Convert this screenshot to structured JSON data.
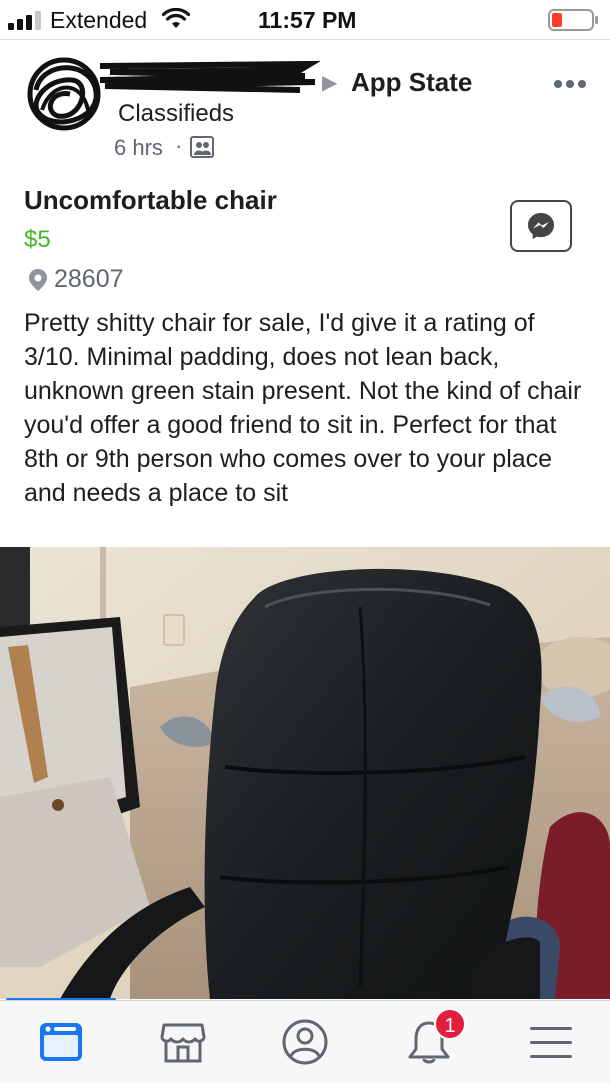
{
  "status_bar": {
    "carrier": "Extended",
    "time": "11:57 PM",
    "signal_icon": "cell-signal-icon",
    "wifi_icon": "wifi-icon",
    "battery_icon": "battery-low-icon",
    "battery_color": "#ff3b30"
  },
  "post": {
    "group_name": "App State",
    "page_name": "Classifieds",
    "time": "6 hrs",
    "separator": "·",
    "audience_icon": "group-audience-icon",
    "more_icon": "more-options-icon"
  },
  "listing": {
    "title": "Uncomfortable chair",
    "price": "$5",
    "zip": "28607",
    "description": "Pretty shitty chair for sale, I'd give it a rating of 3/10. Minimal padding, does not lean back, unknown green stain present. Not the kind of chair you'd offer a good friend to sit in. Perfect for that 8th or 9th person who comes over to your place and needs a place to sit",
    "price_color": "#42b72a",
    "message_icon": "messenger-icon"
  },
  "photo": {
    "subject": "black leather office chair photo"
  },
  "bottom_nav": {
    "items": [
      {
        "icon": "news-feed-icon",
        "active": true
      },
      {
        "icon": "marketplace-icon",
        "active": false
      },
      {
        "icon": "profile-icon",
        "active": false
      },
      {
        "icon": "notifications-icon",
        "active": false
      },
      {
        "icon": "menu-icon",
        "active": false
      }
    ],
    "notification_count": "1",
    "accent": "#1877f2"
  }
}
